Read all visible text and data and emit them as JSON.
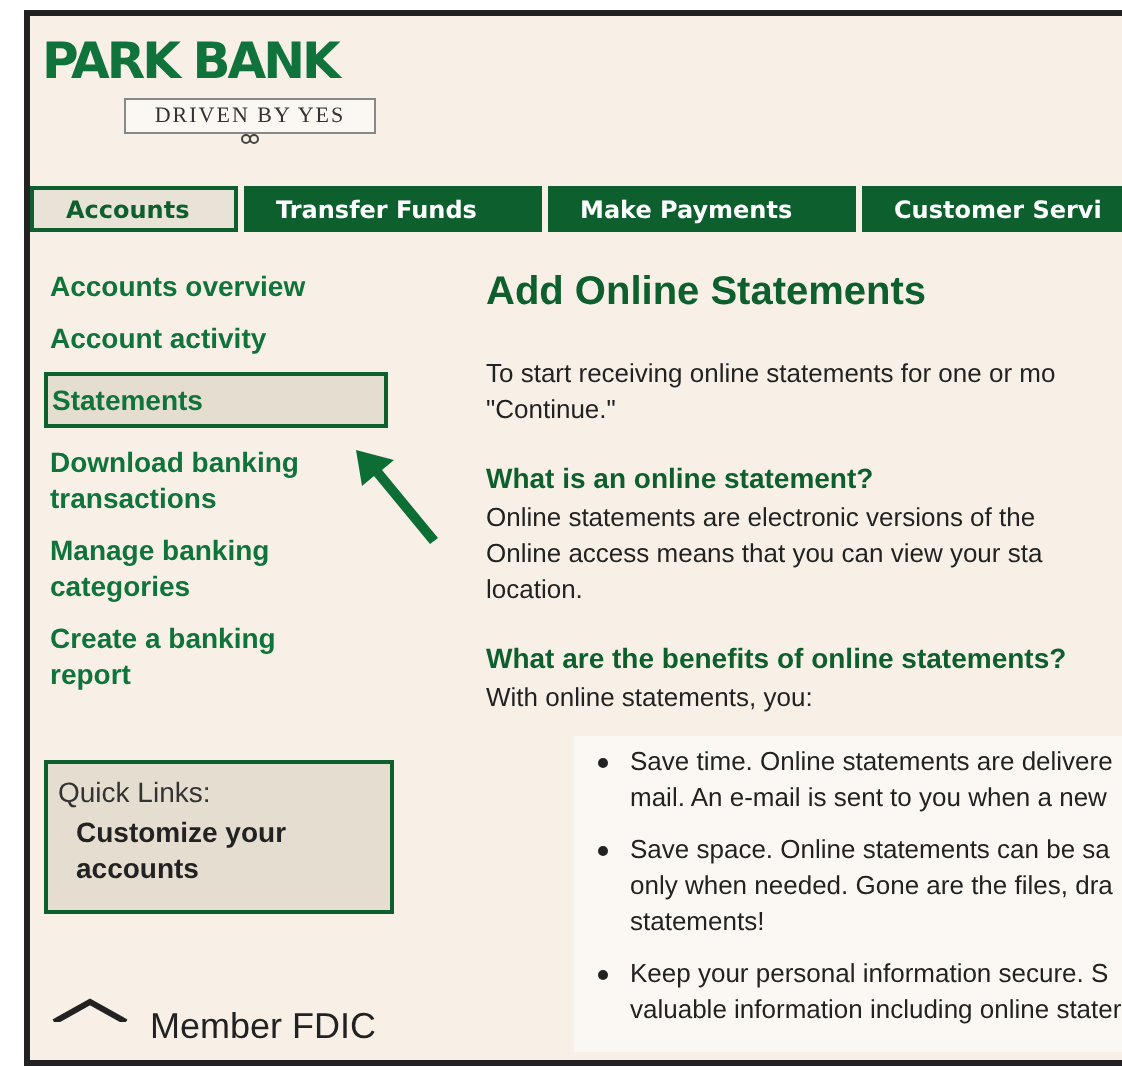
{
  "logo": {
    "name": "PARK BANK",
    "tagline": "DRIVEN BY YES"
  },
  "tabs": [
    {
      "label": "Accounts",
      "selected": true
    },
    {
      "label": "Transfer Funds",
      "selected": false
    },
    {
      "label": "Make Payments",
      "selected": false
    },
    {
      "label": "Customer Servi",
      "selected": false
    }
  ],
  "sidebar": {
    "items": [
      {
        "label": "Accounts overview",
        "selected": false
      },
      {
        "label": "Account activity",
        "selected": false
      },
      {
        "label": "Statements",
        "selected": true
      },
      {
        "label": "Download banking transactions",
        "selected": false
      },
      {
        "label": "Manage banking categories",
        "selected": false
      },
      {
        "label": "Create a banking report",
        "selected": false
      }
    ],
    "quick_links": {
      "title": "Quick Links:",
      "items": [
        "Customize your accounts"
      ]
    },
    "footer": "Member FDIC"
  },
  "main": {
    "title": "Add Online Statements",
    "intro": [
      "To start receiving online statements for one or mo",
      "\"Continue.\""
    ],
    "sections": [
      {
        "heading": "What is an online statement?",
        "lines": [
          "Online statements are electronic versions of the",
          "Online access means that you can view your sta",
          "location."
        ]
      },
      {
        "heading": "What are the benefits of online statements?",
        "lines": [
          "With online statements, you:"
        ],
        "bullets": [
          [
            "Save time. Online statements are delivere",
            "mail. An e-mail is sent to you when a new"
          ],
          [
            "Save space. Online statements can be sa",
            "only when needed. Gone are the files, dra",
            "statements!"
          ],
          [
            "Keep your personal information secure. S",
            "valuable information including online stater"
          ]
        ]
      }
    ]
  }
}
